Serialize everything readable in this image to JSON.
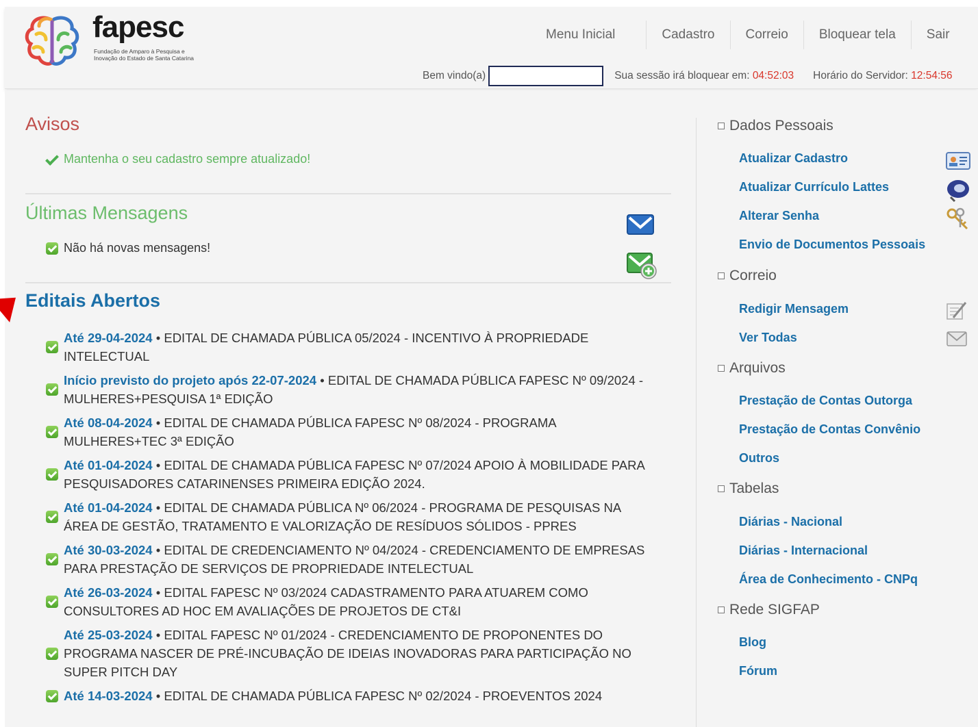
{
  "brand": {
    "name": "fapesc",
    "subtitle": "Fundação de Amparo à Pesquisa e Inovação do Estado de Santa Catarina"
  },
  "topnav": [
    "Menu Inicial",
    "Cadastro",
    "Correio",
    "Bloquear tela",
    "Sair"
  ],
  "status": {
    "welcome_label": "Bem vindo(a)",
    "welcome_value": "",
    "session_label": "Sua sessão irá bloquear em:",
    "session_time": "04:52:03",
    "server_label": "Horário do Servidor:",
    "server_time": "12:54:56"
  },
  "avisos": {
    "title": "Avisos",
    "text": "Mantenha o seu cadastro sempre atualizado!"
  },
  "mensagens": {
    "title": "Últimas Mensagens",
    "text": "Não há novas mensagens!"
  },
  "editais": {
    "title": "Editais Abertos",
    "items": [
      {
        "date": "Até 29-04-2024",
        "text": "EDITAL DE CHAMADA PÚBLICA 05/2024 - INCENTIVO À PROPRIEDADE INTELECTUAL"
      },
      {
        "date": "Início previsto do projeto após 22-07-2024",
        "text": "EDITAL DE CHAMADA PÚBLICA FAPESC Nº 09/2024 - MULHERES+PESQUISA 1ª EDIÇÃO"
      },
      {
        "date": "Até 08-04-2024",
        "text": "EDITAL DE CHAMADA PÚBLICA FAPESC Nº 08/2024 - PROGRAMA MULHERES+TEC 3ª EDIÇÃO"
      },
      {
        "date": "Até 01-04-2024",
        "text": "EDITAL DE CHAMADA PÚBLICA FAPESC Nº 07/2024 APOIO À MOBILIDADE PARA PESQUISADORES CATARINENSES PRIMEIRA EDIÇÃO 2024."
      },
      {
        "date": "Até 01-04-2024",
        "text": "EDITAL DE CHAMADA PÚBLICA Nº 06/2024 - PROGRAMA DE PESQUISAS NA ÁREA DE GESTÃO, TRATAMENTO E VALORIZAÇÃO DE RESÍDUOS SÓLIDOS - PPRES"
      },
      {
        "date": "Até 30-03-2024",
        "text": "EDITAL DE CREDENCIAMENTO Nº 04/2024 - CREDENCIAMENTO DE EMPRESAS PARA PRESTAÇÃO DE SERVIÇOS DE PROPRIEDADE INTELECTUAL"
      },
      {
        "date": "Até 26-03-2024",
        "text": "EDITAL FAPESC Nº 03/2024 CADASTRAMENTO PARA ATUAREM COMO CONSULTORES AD HOC EM AVALIAÇÕES DE PROJETOS DE CT&I"
      },
      {
        "date": "Até 25-03-2024",
        "text": "EDITAL FAPESC Nº 01/2024 - CREDENCIAMENTO DE PROPONENTES DO PROGRAMA NASCER DE PRÉ-INCUBAÇÃO DE IDEIAS INOVADORAS PARA PARTICIPAÇÃO NO SUPER PITCH DAY"
      },
      {
        "date": "Até 14-03-2024",
        "text": "EDITAL DE CHAMADA PÚBLICA FAPESC Nº 02/2024 - PROEVENTOS 2024"
      }
    ]
  },
  "sidebar": {
    "dados": {
      "title": "Dados Pessoais",
      "links": [
        "Atualizar Cadastro",
        "Atualizar Currículo Lattes",
        "Alterar Senha",
        "Envio de Documentos Pessoais"
      ]
    },
    "correio": {
      "title": "Correio",
      "links": [
        "Redigir Mensagem",
        "Ver Todas"
      ]
    },
    "arquivos": {
      "title": "Arquivos",
      "links": [
        "Prestação de Contas Outorga",
        "Prestação de Contas Convênio",
        "Outros"
      ]
    },
    "tabelas": {
      "title": "Tabelas",
      "links": [
        "Diárias - Nacional",
        "Diárias - Internacional",
        "Área de Conhecimento - CNPq"
      ]
    },
    "rede": {
      "title": "Rede SIGFAP",
      "links": [
        "Blog",
        "Fórum"
      ]
    }
  },
  "colors": {
    "accent_blue": "#1b6fa8",
    "avisos_red": "#c0504d",
    "msg_green": "#6cbd6c",
    "status_red": "#d9362b"
  }
}
